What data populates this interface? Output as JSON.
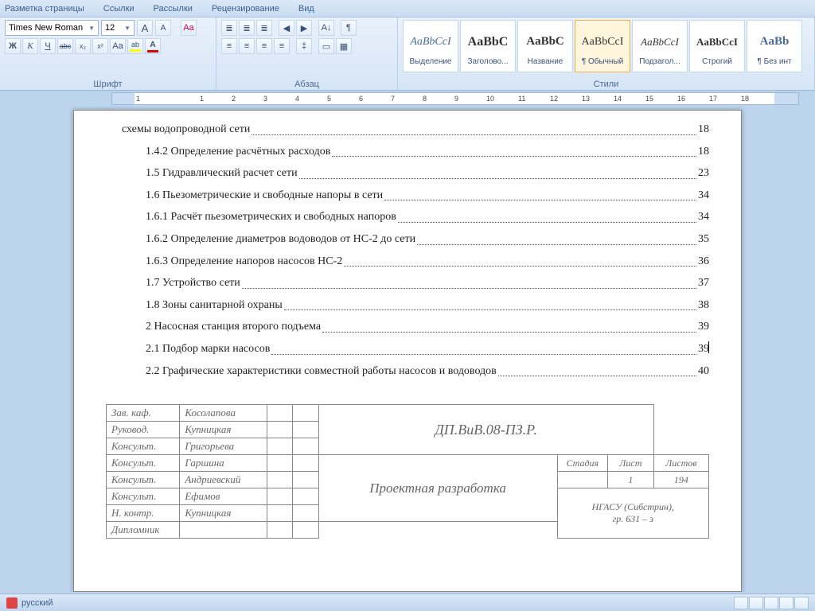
{
  "menu": {
    "items": [
      "Разметка страницы",
      "Ссылки",
      "Рассылки",
      "Рецензирование",
      "Вид"
    ]
  },
  "font": {
    "family": "Times New Roman",
    "size": "12",
    "group_label": "Шрифт",
    "grow": "A",
    "shrink_sup": "▴",
    "shrink": "A",
    "clear": "Aa",
    "bold": "Ж",
    "italic": "К",
    "underline": "Ч",
    "strike": "abc",
    "sub": "x₂",
    "sup": "x²",
    "case": "Aa",
    "highlight": "ab",
    "color": "A"
  },
  "para": {
    "group_label": "Абзац",
    "bullets": "≣",
    "numbers": "≣",
    "multilevel": "≣",
    "outdent": "◀",
    "indent": "▶",
    "sort": "A↓",
    "marks": "¶",
    "al_left": "≡",
    "al_center": "≡",
    "al_right": "≡",
    "al_just": "≡",
    "linesp": "‡",
    "shade": "▭",
    "border": "▦"
  },
  "styles": {
    "group_label": "Стили",
    "items": [
      {
        "preview": "AaBbCcI",
        "label": "Выделение",
        "cls": "em"
      },
      {
        "preview": "AaBbC",
        "label": "Заголово...",
        "cls": "h1"
      },
      {
        "preview": "AaBbC",
        "label": "Название",
        "cls": "title"
      },
      {
        "preview": "AaBbCcI",
        "label": "¶ Обычный",
        "cls": "",
        "selected": true
      },
      {
        "preview": "AaBbCcI",
        "label": "Подзагол...",
        "cls": "sub"
      },
      {
        "preview": "AaBbCcI",
        "label": "Строгий",
        "cls": "strong"
      },
      {
        "preview": "AaBb",
        "label": "¶ Без инт",
        "cls": "h2"
      }
    ]
  },
  "ruler": {
    "ticks": [
      "1",
      "",
      "1",
      "2",
      "3",
      "4",
      "5",
      "6",
      "7",
      "8",
      "9",
      "10",
      "11",
      "12",
      "13",
      "14",
      "15",
      "16",
      "17",
      "18"
    ]
  },
  "toc": [
    {
      "indent": 0,
      "text": "схемы водопроводной сети ",
      "page": "18"
    },
    {
      "indent": 1,
      "text": "1.4.2 Определение расчётных расходов",
      "page": "18"
    },
    {
      "indent": 1,
      "text": "1.5 Гидравлический расчет сети",
      "page": "23"
    },
    {
      "indent": 1,
      "text": "1.6 Пьезометрические и свободные напоры в сети",
      "page": "34"
    },
    {
      "indent": 1,
      "text": "1.6.1 Расчёт пьезометрических и свободных напоров",
      "page": "34"
    },
    {
      "indent": 1,
      "text": "1.6.2 Определение диаметров водоводов от НС-2 до сети ",
      "page": "35"
    },
    {
      "indent": 1,
      "text": "1.6.3 Определение напоров насосов НС-2",
      "page": "36"
    },
    {
      "indent": 1,
      "text": "1.7 Устройство сети",
      "page": "37"
    },
    {
      "indent": 1,
      "text": "1.8 Зоны санитарной охраны",
      "page": "38"
    },
    {
      "indent": 1,
      "text": "2 Насосная станция второго подъема",
      "page": "39"
    },
    {
      "indent": 1,
      "text": "2.1 Подбор марки насосов",
      "page": "39",
      "cursor": true
    },
    {
      "indent": 1,
      "text": "2.2 Графические характеристики совместной работы насосов и водоводов ",
      "page": "40"
    }
  ],
  "titleblock": {
    "rows": [
      {
        "role": "Зав. каф.",
        "name": "Косолапова"
      },
      {
        "role": "Руковод.",
        "name": "Купницкая"
      },
      {
        "role": "Консульт.",
        "name": "Григорьева"
      },
      {
        "role": "Консульт.",
        "name": "Гаршина"
      },
      {
        "role": "Консульт.",
        "name": "Андриевский"
      },
      {
        "role": "Консульт.",
        "name": "Ефимов"
      },
      {
        "role": "Н. контр.",
        "name": "Купницкая"
      },
      {
        "role": "Дипломник",
        "name": ""
      }
    ],
    "code": "ДП.ВиВ.08-ПЗ.Р.",
    "main_title": "Проектная разработка",
    "h_stage": "Стадия",
    "h_sheet": "Лист",
    "h_sheets": "Листов",
    "v_stage": "",
    "v_sheet": "1",
    "v_sheets": "194",
    "org": "НГАСУ (Сибстрин),\nгр. 631 – з"
  },
  "status": {
    "language": "русский"
  }
}
